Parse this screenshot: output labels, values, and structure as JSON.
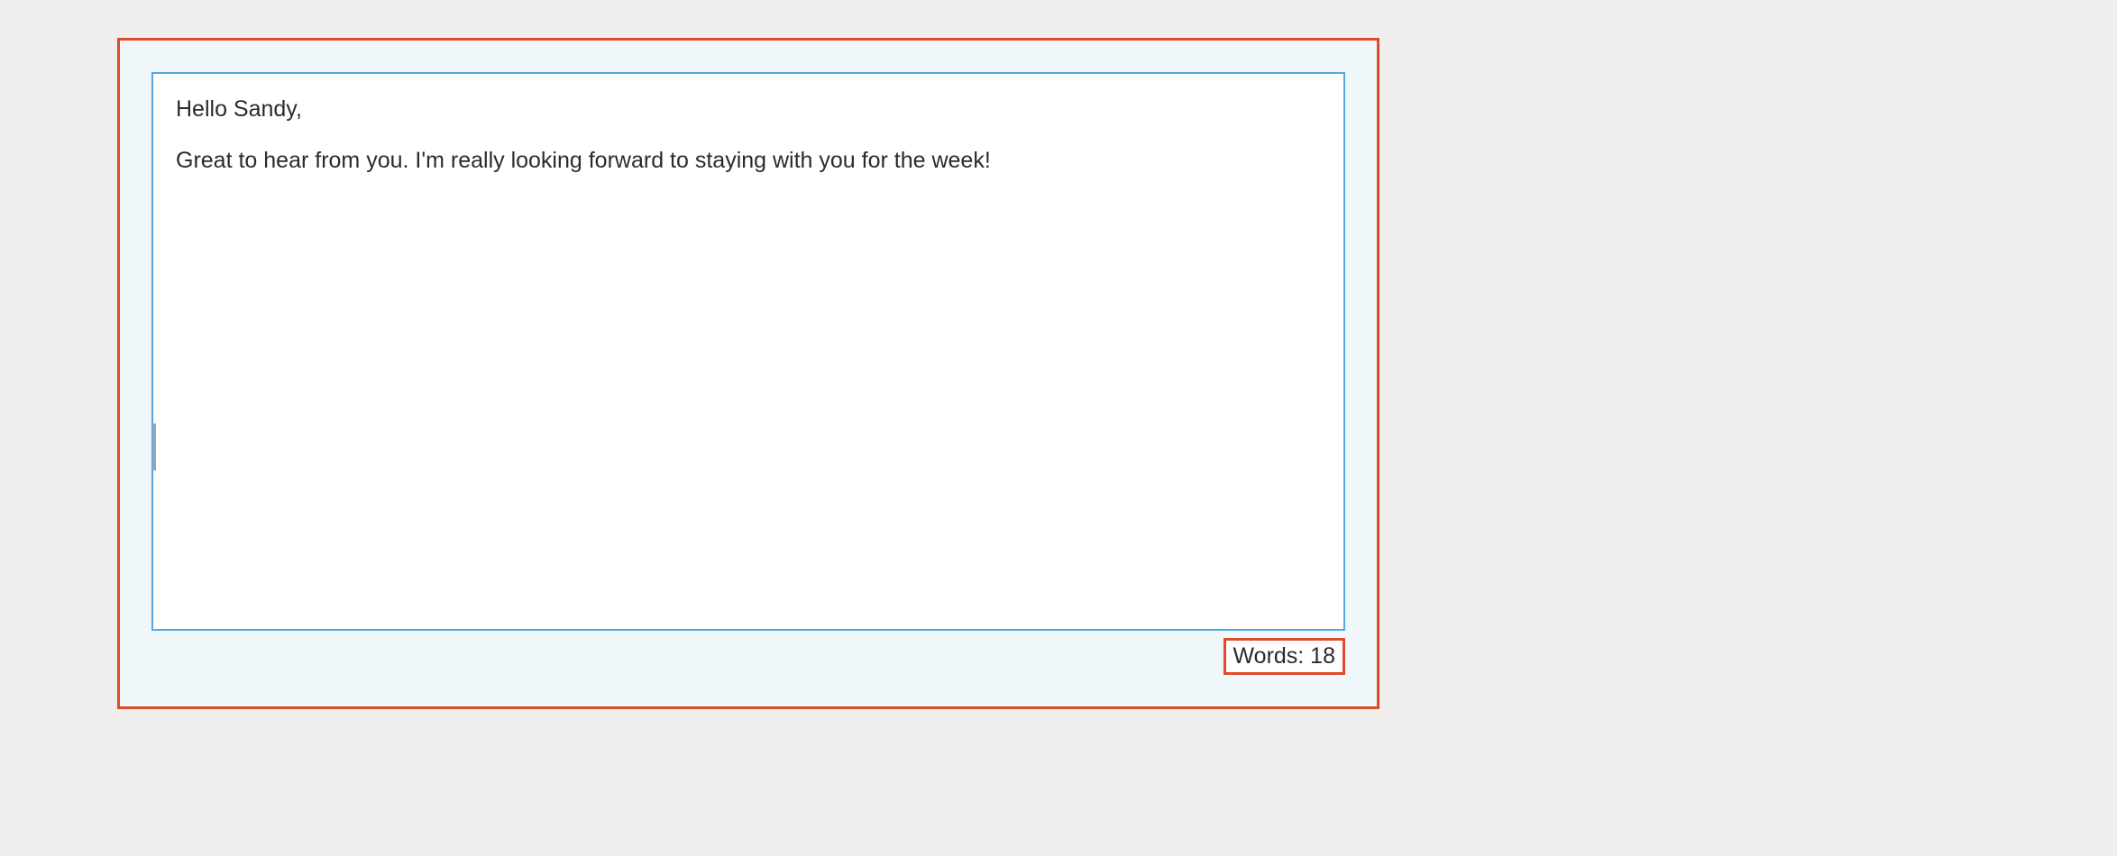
{
  "editor": {
    "paragraphs": [
      "Hello Sandy,",
      "Great to hear from you.  I'm really looking forward to staying with you for the week!"
    ]
  },
  "footer": {
    "word_count_text": "Words: 18"
  }
}
